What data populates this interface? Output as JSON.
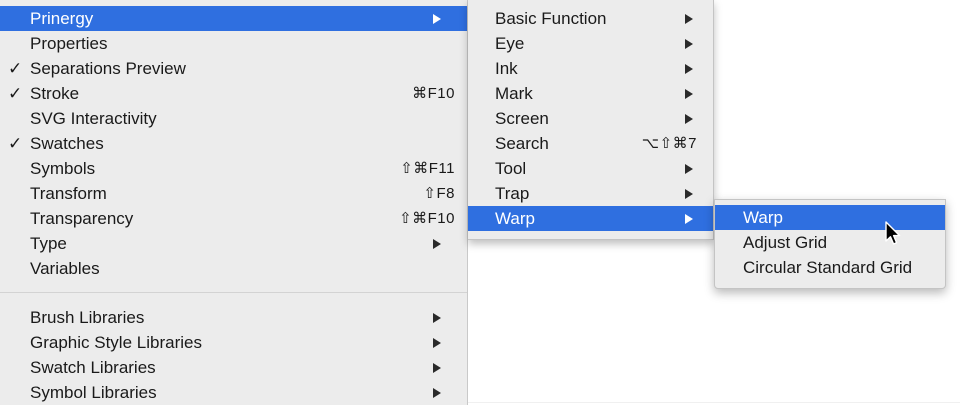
{
  "window_menu": {
    "items_top": [
      {
        "label": "Prinergy",
        "checked": false,
        "shortcut": "",
        "submenu": true,
        "selected": true
      },
      {
        "label": "Properties",
        "checked": false,
        "shortcut": "",
        "submenu": false,
        "selected": false
      },
      {
        "label": "Separations Preview",
        "checked": true,
        "shortcut": "",
        "submenu": false,
        "selected": false
      },
      {
        "label": "Stroke",
        "checked": true,
        "shortcut": "⌘F10",
        "submenu": false,
        "selected": false
      },
      {
        "label": "SVG Interactivity",
        "checked": false,
        "shortcut": "",
        "submenu": false,
        "selected": false
      },
      {
        "label": "Swatches",
        "checked": true,
        "shortcut": "",
        "submenu": false,
        "selected": false
      },
      {
        "label": "Symbols",
        "checked": false,
        "shortcut": "⇧⌘F11",
        "submenu": false,
        "selected": false
      },
      {
        "label": "Transform",
        "checked": false,
        "shortcut": "⇧F8",
        "submenu": false,
        "selected": false
      },
      {
        "label": "Transparency",
        "checked": false,
        "shortcut": "⇧⌘F10",
        "submenu": false,
        "selected": false
      },
      {
        "label": "Type",
        "checked": false,
        "shortcut": "",
        "submenu": true,
        "selected": false
      },
      {
        "label": "Variables",
        "checked": false,
        "shortcut": "",
        "submenu": false,
        "selected": false
      }
    ],
    "items_bottom": [
      {
        "label": "Brush Libraries",
        "submenu": true
      },
      {
        "label": "Graphic Style Libraries",
        "submenu": true
      },
      {
        "label": "Swatch Libraries",
        "submenu": true
      },
      {
        "label": "Symbol Libraries",
        "submenu": true
      }
    ],
    "check_glyph": "✓"
  },
  "prinergy_submenu": {
    "items": [
      {
        "label": "Basic Function",
        "shortcut": "",
        "submenu": true,
        "selected": false
      },
      {
        "label": "Eye",
        "shortcut": "",
        "submenu": true,
        "selected": false
      },
      {
        "label": "Ink",
        "shortcut": "",
        "submenu": true,
        "selected": false
      },
      {
        "label": "Mark",
        "shortcut": "",
        "submenu": true,
        "selected": false
      },
      {
        "label": "Screen",
        "shortcut": "",
        "submenu": true,
        "selected": false
      },
      {
        "label": "Search",
        "shortcut": "⌥⇧⌘7",
        "submenu": false,
        "selected": false
      },
      {
        "label": "Tool",
        "shortcut": "",
        "submenu": true,
        "selected": false
      },
      {
        "label": "Trap",
        "shortcut": "",
        "submenu": true,
        "selected": false
      },
      {
        "label": "Warp",
        "shortcut": "",
        "submenu": true,
        "selected": true
      }
    ]
  },
  "warp_submenu": {
    "items": [
      {
        "label": "Warp",
        "selected": true
      },
      {
        "label": "Adjust Grid",
        "selected": false
      },
      {
        "label": "Circular Standard Grid",
        "selected": false
      }
    ]
  },
  "colors": {
    "highlight": "#2f6fe0",
    "menu_background": "#ececec",
    "text": "#1a1a1a"
  },
  "icons": {
    "cursor": "arrow-pointer-icon",
    "submenu_indicator": "triangle-right-icon",
    "check": "checkmark-icon"
  }
}
